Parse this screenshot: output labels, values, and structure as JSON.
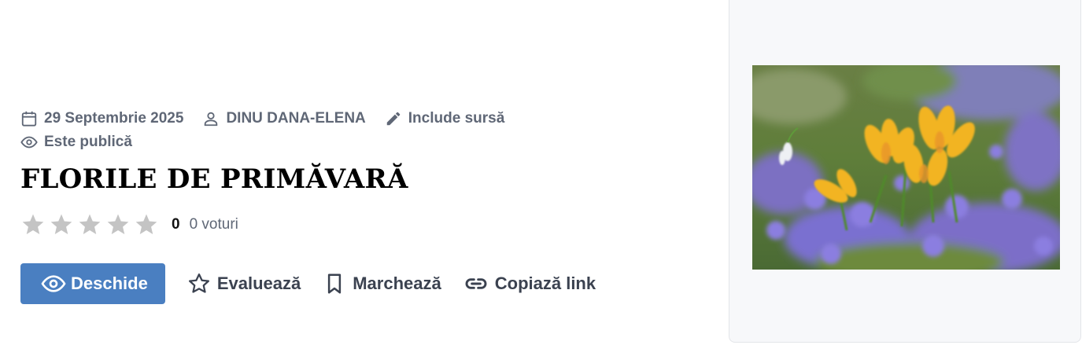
{
  "meta": {
    "date": "29 Septembrie 2025",
    "author": "DINU DANA-ELENA",
    "source": "Include sursă",
    "visibility": "Este publică"
  },
  "title": "FLORILE DE PRIMĂVARĂ",
  "rating": {
    "stars_filled": 0,
    "stars_total": 5,
    "value": "0",
    "votes": "0 voturi"
  },
  "actions": {
    "open": "Deschide",
    "rate": "Evaluează",
    "bookmark": "Marchează",
    "copy_link": "Copiază link"
  },
  "colors": {
    "primary": "#4a7fc1",
    "muted": "#5f6776",
    "star_empty": "#c4c4c4"
  },
  "icons": {
    "date": "calendar-icon",
    "author": "user-icon",
    "source": "pencil-icon",
    "visibility": "eye-icon",
    "open": "eye-icon",
    "rate": "star-outline-icon",
    "bookmark": "bookmark-icon",
    "copy_link": "link-icon"
  }
}
